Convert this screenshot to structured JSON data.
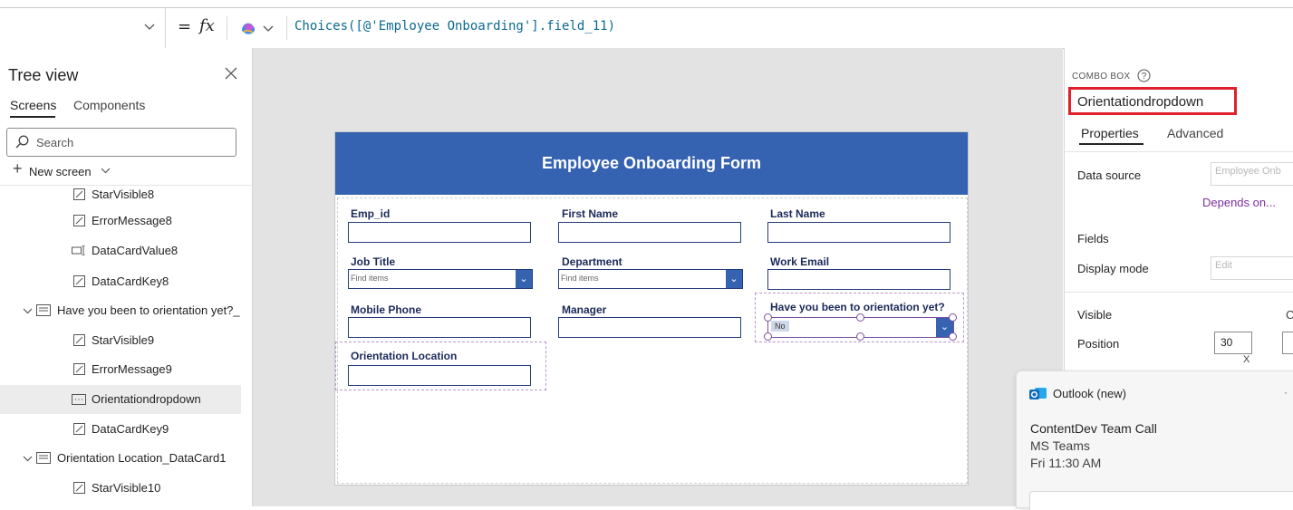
{
  "formula_bar": {
    "equals": "=",
    "fx": "fx",
    "formula": "Choices([@'Employee Onboarding'].field_11)"
  },
  "tree": {
    "title": "Tree view",
    "tabs": [
      "Screens",
      "Components"
    ],
    "search_placeholder": "Search",
    "new_screen": "New screen",
    "items": [
      {
        "label": "StarVisible8",
        "icon": "edit-icon"
      },
      {
        "label": "ErrorMessage8",
        "icon": "edit-icon"
      },
      {
        "label": "DataCardValue8",
        "icon": "text-input-icon"
      },
      {
        "label": "DataCardKey8",
        "icon": "edit-icon"
      },
      {
        "label": "Have you been to orientation yet?_",
        "icon": "card-icon"
      },
      {
        "label": "StarVisible9",
        "icon": "edit-icon"
      },
      {
        "label": "ErrorMessage9",
        "icon": "edit-icon"
      },
      {
        "label": "Orientationdropdown",
        "icon": "combobox-icon"
      },
      {
        "label": "DataCardKey9",
        "icon": "edit-icon"
      },
      {
        "label": "Orientation Location_DataCard1",
        "icon": "card-icon"
      },
      {
        "label": "StarVisible10",
        "icon": "edit-icon"
      }
    ]
  },
  "form": {
    "title": "Employee Onboarding Form",
    "fields": {
      "emp_id": "Emp_id",
      "first_name": "First Name",
      "last_name": "Last Name",
      "job_title": "Job Title",
      "department": "Department",
      "work_email": "Work Email",
      "mobile_phone": "Mobile Phone",
      "manager": "Manager",
      "orientation": "Have you been to orientation yet?",
      "orientation_location": "Orientation Location"
    },
    "combo_placeholder": "Find items",
    "orientation_value": "No"
  },
  "properties": {
    "control_type": "COMBO BOX",
    "control_name": "Orientationdropdown",
    "tabs": [
      "Properties",
      "Advanced"
    ],
    "data_source_label": "Data source",
    "data_source_value": "Employee Onb",
    "depends_on": "Depends on...",
    "fields_label": "Fields",
    "display_mode_label": "Display mode",
    "display_mode_value": "Edit",
    "visible_label": "Visible",
    "visible_value": "C",
    "position_label": "Position",
    "position_x": "30",
    "x_label": "X"
  },
  "toast": {
    "app": "Outlook (new)",
    "title": "ContentDev Team Call",
    "location": "MS Teams",
    "time": "Fri 11:30 AM"
  },
  "colors": {
    "accent": "#3562b1",
    "highlight_box": "#e0202a"
  }
}
